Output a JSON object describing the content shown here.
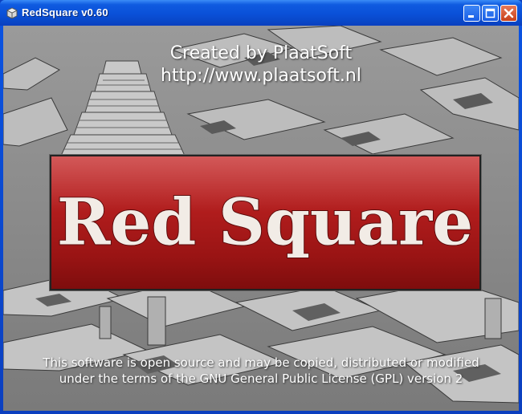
{
  "window": {
    "title": "RedSquare v0.60",
    "icon": "app-icon",
    "controls": {
      "minimize_icon": "minimize-icon",
      "maximize_icon": "maximize-icon",
      "close_icon": "close-icon"
    }
  },
  "splash": {
    "credit_line1": "Created by PlaatSoft",
    "credit_line2": "http://www.plaatsoft.nl",
    "logo_text": "Red Square",
    "license_line1": "This software is open source and may be copied, distributed or modified",
    "license_line2": "under the terms of the GNU General Public License (GPL) version 2"
  },
  "colors": {
    "titlebar": "#0a50d8",
    "logo_red": "#b11d1d",
    "logo_text": "#f2ece6",
    "close_button": "#d4522b"
  }
}
